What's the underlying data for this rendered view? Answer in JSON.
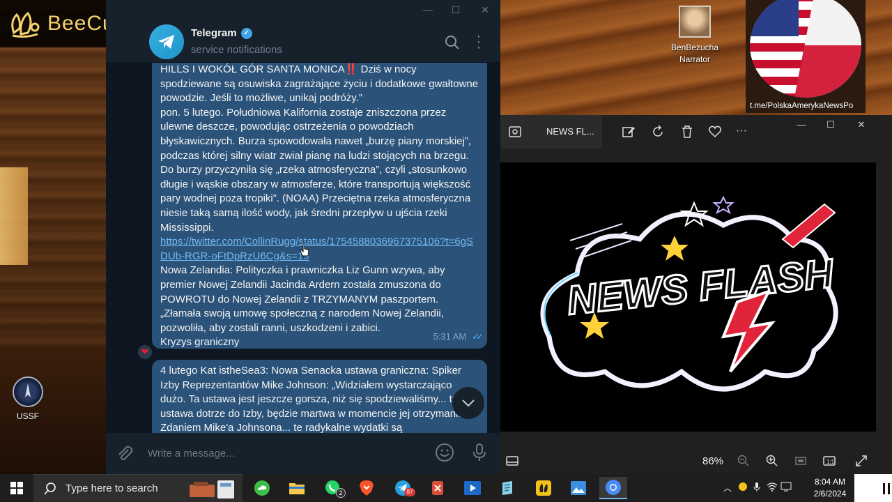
{
  "watermark": {
    "text": "BeeCut",
    "color": "#f4d36b"
  },
  "desktop_icons": [
    {
      "label": "USSF",
      "icon": "space-force-icon"
    }
  ],
  "narrator": {
    "name": "BenBezucha",
    "role": "Narrator"
  },
  "channel_overlay": {
    "url": "t.me/PolskaAmerykaNewsPo"
  },
  "telegram": {
    "chat_name": "Telegram",
    "chat_status": "service notifications",
    "messages": [
      {
        "paragraphs": [
          "HILLS I WOKÓŁ GÓR SANTA MONICA‼️ Dziś w nocy spodziewane są osuwiska zagrażające życiu i dodatkowe gwałtowne powodzie. Jeśli to możliwe, unikaj podróży.”",
          "pon. 5 lutego. Południowa Kalifornia zostaje zniszczona przez ulewne deszcze, powodując ostrzeżenia o powodziach błyskawicznych. Burza spowodowała nawet „burzę piany morskiej”, podczas której silny wiatr zwiał pianę na ludzi stojących na brzegu. Do burzy przyczyniła się „rzeka atmosferyczna”, czyli „stosunkowo długie i wąskie obszary w atmosferze, które transportują większość pary wodnej poza tropiki”. (NOAA) Przeciętna rzeka atmosferyczna niesie taką samą ilość wody, jak średni przepływ u ujścia rzeki Mississippi."
        ],
        "link": "https://twitter.com/CollinRugg/status/1754588036967375106?t=6gSDUb-RGR-oFtDpRzU6Cg&s=19",
        "paragraphs_after": [
          "Nowa Zelandia: Polityczka i prawniczka Liz Gunn wzywa, aby premier Nowej Zelandii Jacinda Ardern została zmuszona do POWROTU do Nowej Zelandii z TRZYMANYM paszportem. „Złamała swoją umowę społeczną z narodem Nowej Zelandii, pozwoliła, aby zostali ranni, uszkodzeni i zabici.",
          "Kryzys graniczny"
        ],
        "time": "5:31 AM",
        "reaction": "❤"
      },
      {
        "paragraphs": [
          "4 lutego Kat istheSea3: Nowa Senacka ustawa graniczna: Spiker Izby Reprezentantów Mike Johnson: „Widziałem wystarczająco dużo. Ta ustawa jest jeszcze gorsza, niż się spodziewaliśmy... ta ustawa dotrze do Izby, będzie martwa w momencie jej otrzymania”. Zdaniem Mike'a Johnsona... te radykalne wydatki są"
        ]
      }
    ],
    "composer_placeholder": "Write a message..."
  },
  "photos_viewer": {
    "title": "NEWS FL...",
    "zoom": "86%",
    "image_text": "NEWS FLASH"
  },
  "taskbar": {
    "search_placeholder": "Type here to search",
    "whatsapp_badge": "2",
    "telegram_badge": "87",
    "time": "8:04 AM",
    "date": "2/6/2024"
  }
}
